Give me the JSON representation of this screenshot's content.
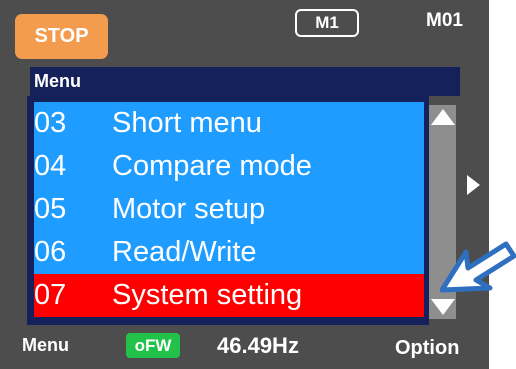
{
  "header": {
    "status_badge": "STOP",
    "motor_indicator": "M1",
    "mode_code": "M01"
  },
  "menu": {
    "title": "Menu",
    "items": [
      {
        "number": "03",
        "label": "Short menu"
      },
      {
        "number": "04",
        "label": "Compare mode"
      },
      {
        "number": "05",
        "label": "Motor setup"
      },
      {
        "number": "06",
        "label": "Read/Write"
      },
      {
        "number": "07",
        "label": "System setting"
      }
    ],
    "selected_index": 4
  },
  "footer": {
    "left_softkey": "Menu",
    "direction_badge": "oFW",
    "frequency": "46.49Hz",
    "right_softkey": "Option"
  },
  "colors": {
    "screen_background": "#4d4d4d",
    "stop_badge": "#f39c4e",
    "menu_header": "#15215a",
    "menu_item": "#1f9cff",
    "menu_item_selected": "#ff0000",
    "direction_badge": "#22c24a",
    "callout_arrow": "#2f6fc0"
  },
  "icons": {
    "scroll_up": "triangle-up-icon",
    "scroll_down": "triangle-down-icon",
    "next_page": "triangle-right-icon",
    "callout": "callout-arrow-icon"
  }
}
